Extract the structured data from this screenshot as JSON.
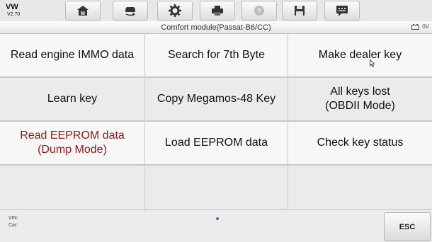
{
  "vehicle": {
    "make": "VW",
    "version": "V2.70"
  },
  "toolbar": {
    "buttons": [
      {
        "name": "home-button",
        "icon": "home-icon"
      },
      {
        "name": "vehicle-swap-button",
        "icon": "car-swap-icon"
      },
      {
        "name": "settings-button",
        "icon": "gear-icon"
      },
      {
        "name": "print-button",
        "icon": "printer-icon"
      },
      {
        "name": "help-button",
        "icon": "help-icon"
      },
      {
        "name": "save-button",
        "icon": "floppy-disk-icon"
      },
      {
        "name": "message-button",
        "icon": "message-icon"
      }
    ]
  },
  "titlebar": {
    "title": "Comfort module(Passat-B6/CC)",
    "battery": "0V"
  },
  "functions": [
    [
      "Read engine IMMO data",
      "Search for 7th Byte",
      "Make dealer key"
    ],
    [
      "Learn key",
      "Copy Megamos-48 Key",
      "All keys lost\n(OBDII Mode)"
    ],
    [
      "Read EEPROM data\n(Dump Mode)",
      "Load EEPROM data",
      "Check key status"
    ],
    [
      "",
      "",
      ""
    ]
  ],
  "footer": {
    "vin_label": "VIN:",
    "car_label": "Car:",
    "esc_label": "ESC"
  },
  "colors": {
    "accent_red": "#8a1a1a",
    "dot_blue": "#3a78c9"
  }
}
